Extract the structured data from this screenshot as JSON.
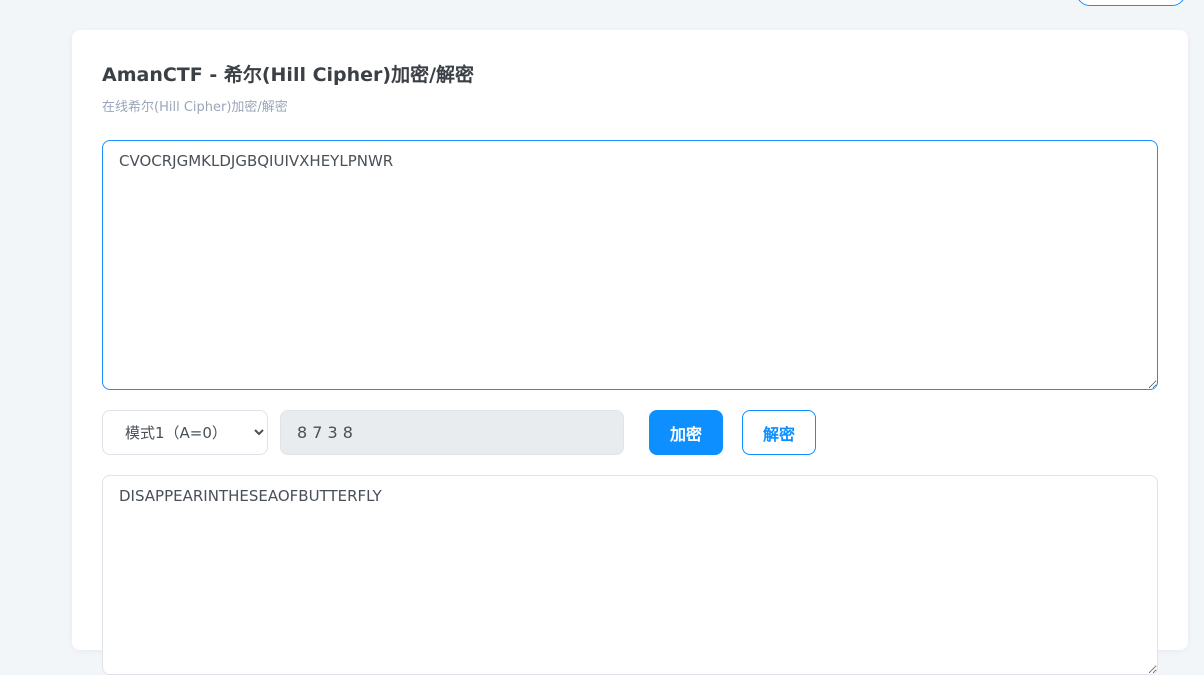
{
  "card": {
    "title": "AmanCTF - 希尔(Hill Cipher)加密/解密",
    "subtitle": "在线希尔(Hill Cipher)加密/解密"
  },
  "input": {
    "value": "CVOCRJGMKLDJGBQIUIVXHEYLPNWR"
  },
  "controls": {
    "mode_selected": "模式1（A=0）",
    "key_value": "8 7 3 8",
    "encrypt_label": "加密",
    "decrypt_label": "解密"
  },
  "output": {
    "value": "DISAPPEARINTHESEAOFBUTTERFLY"
  },
  "colors": {
    "accent": "#0d8fff",
    "page_background": "#f3f6f9",
    "key_field_background": "#e9ecef"
  }
}
